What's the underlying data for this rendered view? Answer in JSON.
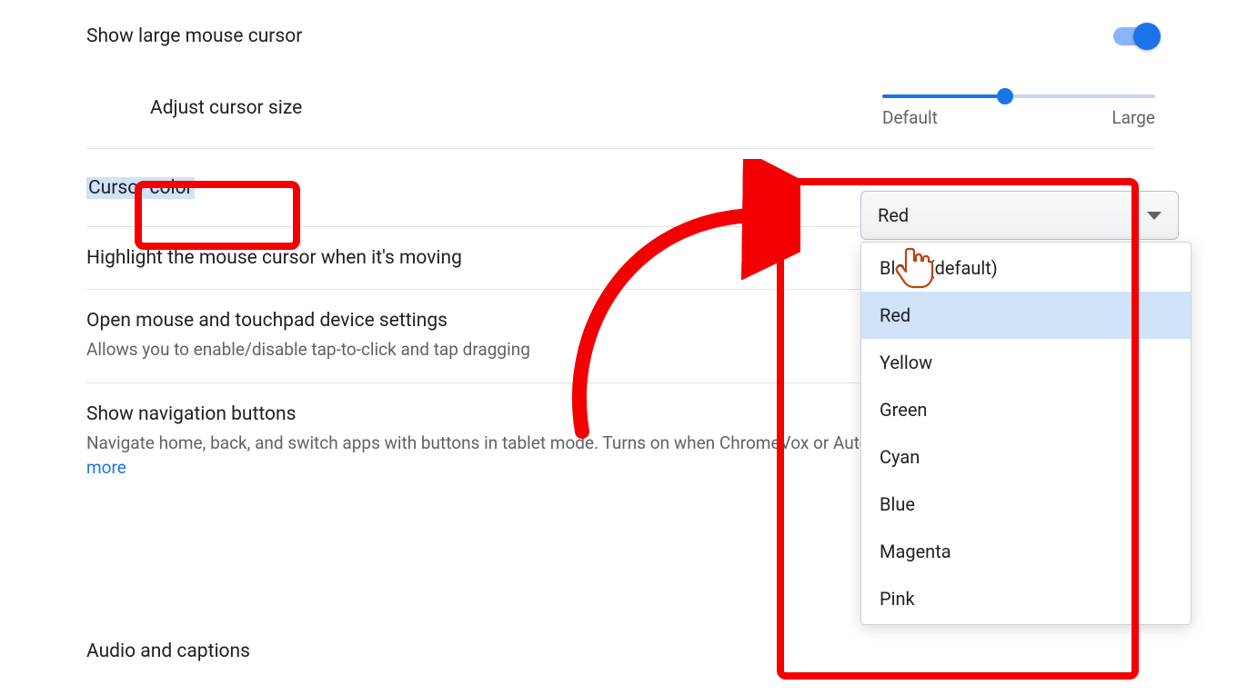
{
  "rows": {
    "large_cursor": {
      "title": "Show large mouse cursor"
    },
    "adjust_size": {
      "title": "Adjust cursor size",
      "min_label": "Default",
      "max_label": "Large"
    },
    "cursor_color": {
      "title": "Cursor color",
      "selected": "Red",
      "options": [
        "Black (default)",
        "Red",
        "Yellow",
        "Green",
        "Cyan",
        "Blue",
        "Magenta",
        "Pink"
      ]
    },
    "highlight_cursor": {
      "title": "Highlight the mouse cursor when it's moving"
    },
    "mouse_touchpad": {
      "title": "Open mouse and touchpad device settings",
      "sub": "Allows you to enable/disable tap-to-click and tap dragging"
    },
    "nav_buttons": {
      "title": "Show navigation buttons",
      "sub_prefix": "Navigate home, back, and switch apps with buttons in tablet mode. Turns on when ChromeVox or Automatic clicks is enabled.  ",
      "learn_more": "Learn more"
    }
  },
  "section": {
    "audio": "Audio and captions"
  },
  "colors": {
    "accent": "#1a73e8",
    "annotation": "#f40000"
  }
}
